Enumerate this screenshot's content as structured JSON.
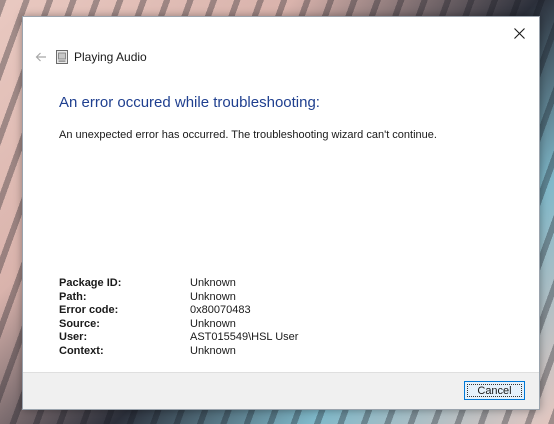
{
  "window": {
    "title": "Playing Audio",
    "close_icon": "close-icon",
    "back_icon": "back-arrow-icon",
    "app_icon": "troubleshooter-icon"
  },
  "main": {
    "heading": "An error occured while troubleshooting:",
    "message": "An unexpected error has occurred. The troubleshooting wizard can't continue.",
    "details": [
      {
        "key": "Package ID:",
        "value": "Unknown"
      },
      {
        "key": "Path:",
        "value": "Unknown"
      },
      {
        "key": "Error code:",
        "value": "0x80070483"
      },
      {
        "key": "Source:",
        "value": "Unknown"
      },
      {
        "key": "User:",
        "value": "AST015549\\HSL User"
      },
      {
        "key": "Context:",
        "value": "Unknown"
      }
    ]
  },
  "footer": {
    "cancel_label": "Cancel"
  },
  "colors": {
    "heading": "#1f3f8f",
    "button_border": "#0078d7",
    "button_fill": "#e5f1fb",
    "footer_bg": "#f0f0f0"
  }
}
